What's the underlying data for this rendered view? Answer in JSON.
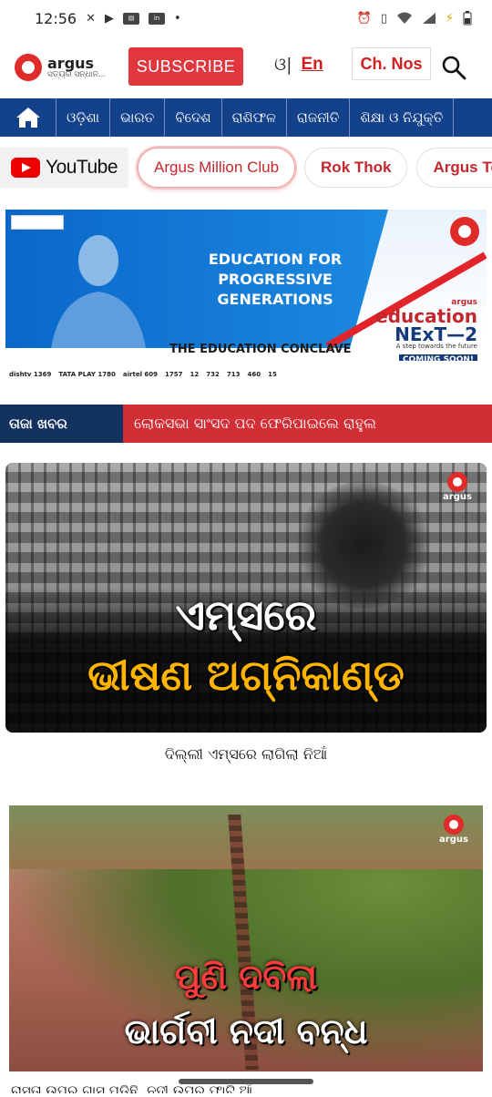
{
  "status_bar": {
    "time": "12:56",
    "app_icons": [
      "missed-call-icon",
      "youtube-icon",
      "news-icon",
      "linkedin-icon"
    ],
    "right_icons": [
      "alarm-icon",
      "vibrate-icon",
      "wifi-icon",
      "signal-icon",
      "battery-saver-icon",
      "battery-icon"
    ]
  },
  "header": {
    "logo_name": "argus",
    "logo_tagline": "ସତ୍ୟର ସନ୍ଧାନ...",
    "subscribe_label": "SUBSCRIBE",
    "lang_odia": "ଓ|",
    "lang_en": "En",
    "channel_numbers_label": "Ch. Nos"
  },
  "nav": {
    "items": [
      "ଓଡ଼ିଶା",
      "ଭାରତ",
      "ବିଦେଶ",
      "ରାଶିଫଳ",
      "ରାଜନୀତି",
      "ଶିକ୍ଷା ଓ ନିଯୁକ୍ତି"
    ]
  },
  "chips": {
    "youtube_label": "YouTube",
    "items": [
      "Argus Million Club",
      "Rok Thok",
      "Argus Te"
    ]
  },
  "banner": {
    "headline_line1": "EDUCATION FOR",
    "headline_line2": "PROGRESSIVE GENERATIONS",
    "conclave": "THE EDUCATION CONCLAVE",
    "edu_brand_small": "argus",
    "edu_word": "education",
    "edu_next": "NExT—2",
    "edu_tagline": "A step towards the future",
    "coming_soon": "COMING SOON!",
    "channels": [
      "dishtv 1369",
      "TATA PLAY 1780",
      "airtel 609",
      "1757",
      "12",
      "732",
      "713",
      "460",
      "15"
    ]
  },
  "breaking": {
    "label": "ତାଜା ଖବର",
    "text": "ଲୋକସଭା ସାଂସଦ ପଦ ଫେରିପାଇଲେ ରାହୁଲ"
  },
  "stories": [
    {
      "overlay_line1": "ଏମ୍ସରେ",
      "overlay_line2": "ଭୀଷଣ ଅଗ୍ନିକାଣ୍ଡ",
      "caption": "ଦିଲ୍ଲୀ ଏମ୍ସରେ ଲାଗିଲା ନିଆଁ"
    },
    {
      "overlay_line1": "ପୁଣି ଦବିଲା",
      "overlay_line2": "ଭାର୍ଗବୀ ନଦୀ ବନ୍ଧ",
      "caption": "ରାସ୍ତା ଉପର ଗାସ ପଡ଼ିଛି, ନଦୀ ଉପର ଫାଟି ଆଁ"
    }
  ],
  "image_logo_text": "argus"
}
